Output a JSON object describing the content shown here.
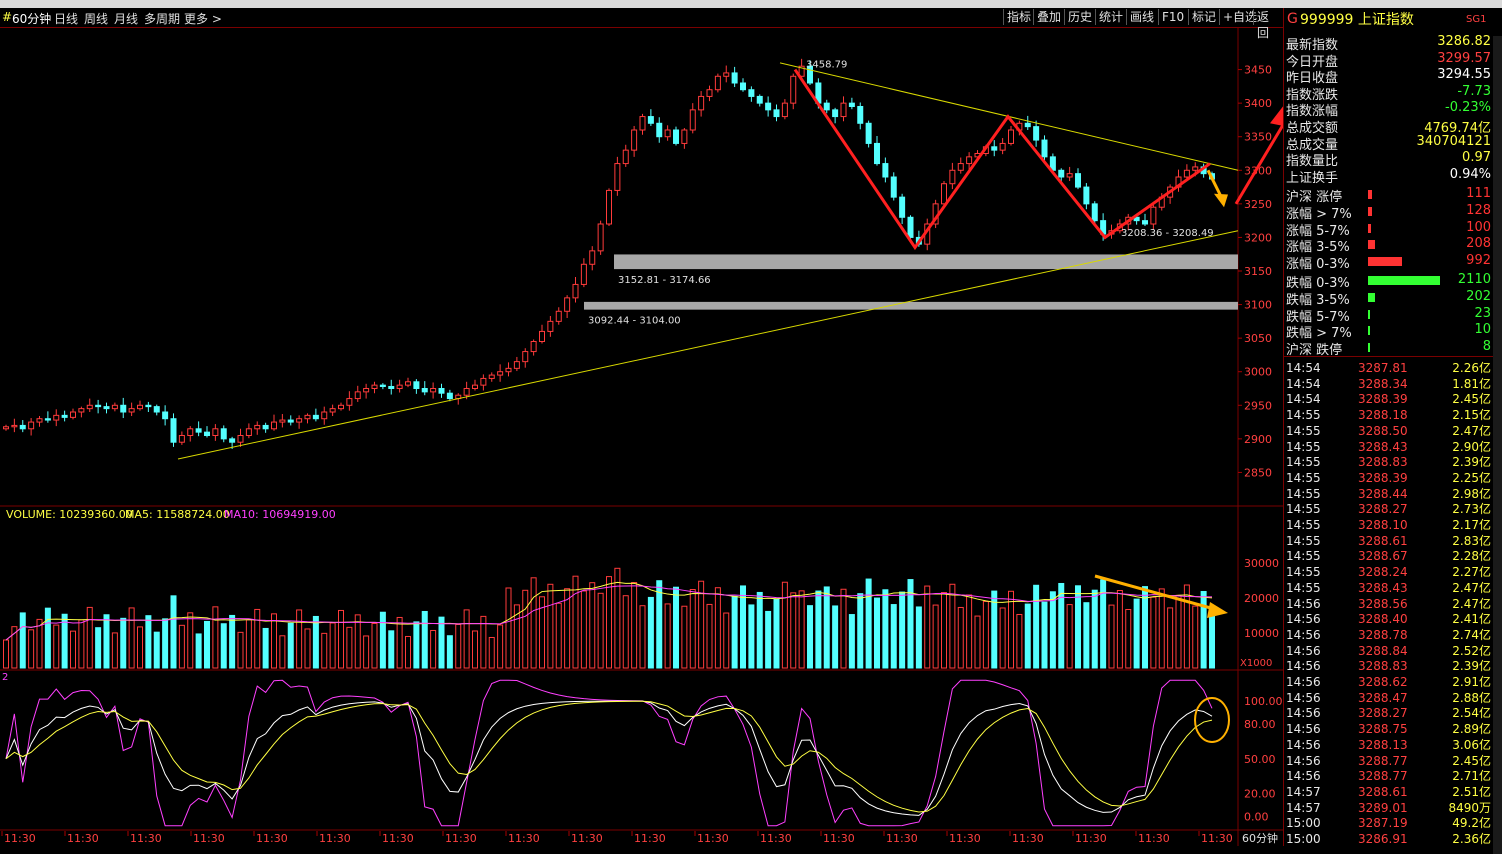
{
  "toolbar": {
    "period_label": "60分钟",
    "tabs": [
      "日线",
      "周线",
      "月线",
      "多周期",
      "更多 >"
    ],
    "right_buttons": [
      "指标",
      "叠加",
      "历史",
      "统计",
      "画线",
      "F10",
      "标记",
      "+自选",
      "返回"
    ]
  },
  "quote": {
    "market_flag": "G",
    "code": "999999",
    "name": "上证指数",
    "sg": "SG1",
    "fields": [
      {
        "label": "最新指数",
        "value": "3286.82",
        "color": "#ffff44"
      },
      {
        "label": "今日开盘",
        "value": "3299.57",
        "color": "#ff4040"
      },
      {
        "label": "昨日收盘",
        "value": "3294.55",
        "color": "#ffffff"
      },
      {
        "label": "指数涨跌",
        "value": "-7.73",
        "color": "#33ff33"
      },
      {
        "label": "指数涨幅",
        "value": "-0.23%",
        "color": "#33ff33"
      },
      {
        "label": "总成交额",
        "value": "4769.74亿",
        "color": "#ffff44"
      },
      {
        "label": "总成交量",
        "value": "340704121",
        "color": "#ffff44"
      },
      {
        "label": "指数量比",
        "value": "0.97",
        "color": "#ffff44"
      },
      {
        "label": "上证换手",
        "value": "0.94%",
        "color": "#ffffff"
      }
    ],
    "distribution": [
      {
        "label": "沪深 涨停",
        "value": "111",
        "count": 111,
        "color": "#ff3333"
      },
      {
        "label": "涨幅 > 7%",
        "value": "128",
        "count": 128,
        "color": "#ff3333"
      },
      {
        "label": "涨幅 5-7%",
        "value": "100",
        "count": 100,
        "color": "#ff3333"
      },
      {
        "label": "涨幅 3-5%",
        "value": "208",
        "count": 208,
        "color": "#ff3333"
      },
      {
        "label": "涨幅 0-3%",
        "value": "992",
        "count": 992,
        "color": "#ff3333"
      },
      {
        "label": "跌幅 0-3%",
        "value": "2110",
        "count": 2110,
        "color": "#33ff33"
      },
      {
        "label": "跌幅 3-5%",
        "value": "202",
        "count": 202,
        "color": "#33ff33"
      },
      {
        "label": "跌幅 5-7%",
        "value": "23",
        "count": 23,
        "color": "#33ff33"
      },
      {
        "label": "跌幅 > 7%",
        "value": "10",
        "count": 10,
        "color": "#33ff33"
      },
      {
        "label": "沪深 跌停",
        "value": "8",
        "count": 8,
        "color": "#33ff33"
      }
    ],
    "ticks": [
      [
        "14:54",
        "3287.81",
        "2.26亿"
      ],
      [
        "14:54",
        "3288.34",
        "1.81亿"
      ],
      [
        "14:54",
        "3288.39",
        "2.45亿"
      ],
      [
        "14:55",
        "3288.18",
        "2.15亿"
      ],
      [
        "14:55",
        "3288.50",
        "2.47亿"
      ],
      [
        "14:55",
        "3288.43",
        "2.90亿"
      ],
      [
        "14:55",
        "3288.83",
        "2.39亿"
      ],
      [
        "14:55",
        "3288.39",
        "2.25亿"
      ],
      [
        "14:55",
        "3288.44",
        "2.98亿"
      ],
      [
        "14:55",
        "3288.27",
        "2.73亿"
      ],
      [
        "14:55",
        "3288.10",
        "2.17亿"
      ],
      [
        "14:55",
        "3288.61",
        "2.83亿"
      ],
      [
        "14:55",
        "3288.67",
        "2.28亿"
      ],
      [
        "14:55",
        "3288.24",
        "2.27亿"
      ],
      [
        "14:55",
        "3288.43",
        "2.47亿"
      ],
      [
        "14:56",
        "3288.56",
        "2.47亿"
      ],
      [
        "14:56",
        "3288.40",
        "2.41亿"
      ],
      [
        "14:56",
        "3288.78",
        "2.74亿"
      ],
      [
        "14:56",
        "3288.84",
        "2.52亿"
      ],
      [
        "14:56",
        "3288.83",
        "2.39亿"
      ],
      [
        "14:56",
        "3288.62",
        "2.91亿"
      ],
      [
        "14:56",
        "3288.47",
        "2.88亿"
      ],
      [
        "14:56",
        "3288.27",
        "2.54亿"
      ],
      [
        "14:56",
        "3288.75",
        "2.89亿"
      ],
      [
        "14:56",
        "3288.13",
        "3.06亿"
      ],
      [
        "14:56",
        "3288.77",
        "2.45亿"
      ],
      [
        "14:56",
        "3288.77",
        "2.71亿"
      ],
      [
        "14:57",
        "3288.61",
        "2.51亿"
      ],
      [
        "14:57",
        "3289.01",
        "8490万"
      ],
      [
        "15:00",
        "3287.19",
        "49.2亿"
      ],
      [
        "15:00",
        "3286.91",
        "2.36亿"
      ]
    ]
  },
  "chart_data": {
    "type": "candlestick",
    "price_axis": {
      "ticks": [
        2850,
        2900,
        2950,
        3000,
        3050,
        3100,
        3150,
        3200,
        3250,
        3300,
        3350,
        3400,
        3450
      ],
      "range": [
        2800,
        3500
      ]
    },
    "annotations": {
      "high_label": "3458.79",
      "zone1_label": "3152.81 - 3174.66",
      "zone2_label": "3092.44 - 3104.00",
      "low_label": "3208.36 - 3208.49"
    },
    "volume": {
      "label": "VOLUME: 10239360.00",
      "ma5_label": "MA5: 11588724.00",
      "ma10_label": "MA10: 10694919.00",
      "ticks": [
        10000,
        20000,
        30000
      ],
      "unit": "X1000"
    },
    "kdj": {
      "label": "2",
      "ticks": [
        "100.00",
        "80.00",
        "50.00",
        "20.00",
        "0.00"
      ]
    },
    "time_labels": [
      "11:30",
      "11:30",
      "11:30",
      "11:30",
      "11:30",
      "11:30",
      "11:30",
      "11:30",
      "11:30",
      "11:30",
      "11:30",
      "11:30",
      "11:30",
      "11:30",
      "11:30",
      "11:30",
      "11:30",
      "11:30",
      "11:30",
      "11:30"
    ],
    "period_footer": "60分钟",
    "closes": [
      2918,
      2920,
      2915,
      2925,
      2930,
      2928,
      2935,
      2932,
      2940,
      2945,
      2950,
      2948,
      2945,
      2950,
      2940,
      2945,
      2950,
      2948,
      2940,
      2930,
      2895,
      2905,
      2915,
      2910,
      2905,
      2915,
      2900,
      2895,
      2905,
      2915,
      2920,
      2915,
      2925,
      2928,
      2925,
      2930,
      2935,
      2930,
      2940,
      2945,
      2950,
      2960,
      2970,
      2975,
      2980,
      2978,
      2975,
      2980,
      2985,
      2975,
      2970,
      2975,
      2968,
      2960,
      2965,
      2975,
      2980,
      2990,
      2995,
      3000,
      3005,
      3015,
      3030,
      3045,
      3060,
      3075,
      3090,
      3110,
      3130,
      3160,
      3180,
      3220,
      3270,
      3310,
      3330,
      3360,
      3380,
      3370,
      3350,
      3360,
      3340,
      3360,
      3390,
      3410,
      3420,
      3440,
      3445,
      3430,
      3420,
      3410,
      3400,
      3390,
      3380,
      3400,
      3440,
      3455,
      3430,
      3400,
      3390,
      3380,
      3400,
      3395,
      3370,
      3340,
      3310,
      3290,
      3260,
      3230,
      3200,
      3190,
      3220,
      3250,
      3280,
      3300,
      3310,
      3320,
      3325,
      3335,
      3330,
      3340,
      3360,
      3370,
      3365,
      3345,
      3320,
      3300,
      3290,
      3295,
      3275,
      3250,
      3225,
      3205,
      3210,
      3220,
      3230,
      3225,
      3220,
      3245,
      3260,
      3275,
      3290,
      3300,
      3305,
      3295,
      3287
    ]
  }
}
